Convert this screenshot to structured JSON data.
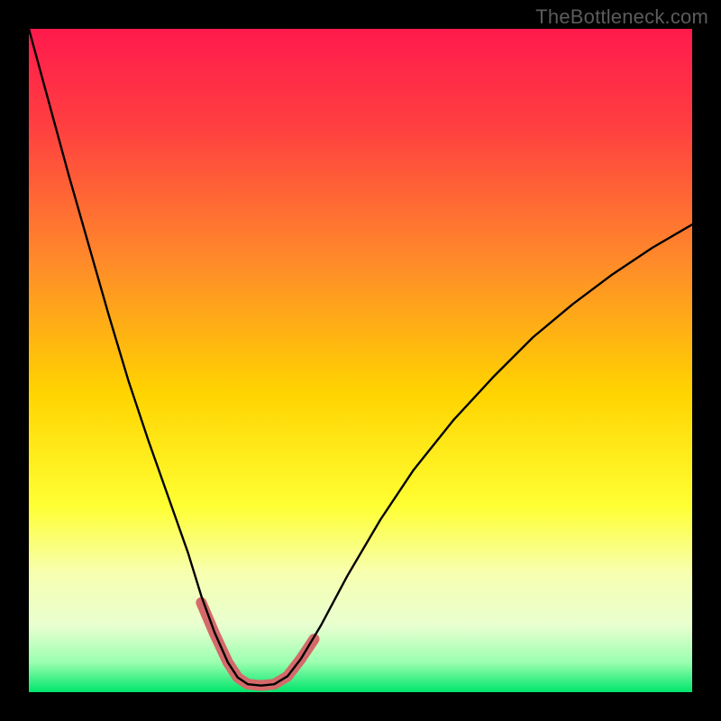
{
  "watermark": "TheBottleneck.com",
  "chart_data": {
    "type": "line",
    "title": "",
    "xlabel": "",
    "ylabel": "",
    "xlim": [
      0,
      100
    ],
    "ylim": [
      0,
      100
    ],
    "grid": false,
    "legend": false,
    "background_gradient": {
      "stops": [
        {
          "offset": 0.0,
          "color": "#ff1a4d"
        },
        {
          "offset": 0.15,
          "color": "#ff4040"
        },
        {
          "offset": 0.35,
          "color": "#ff8a2a"
        },
        {
          "offset": 0.55,
          "color": "#ffd400"
        },
        {
          "offset": 0.72,
          "color": "#ffff33"
        },
        {
          "offset": 0.82,
          "color": "#f7ffb0"
        },
        {
          "offset": 0.9,
          "color": "#e8ffd0"
        },
        {
          "offset": 0.955,
          "color": "#9bffb0"
        },
        {
          "offset": 1.0,
          "color": "#00e56b"
        }
      ]
    },
    "series": [
      {
        "name": "bottleneck-curve",
        "stroke": "#000000",
        "stroke_width": 2.4,
        "x": [
          0,
          3,
          6,
          9,
          12,
          15,
          18,
          21,
          24,
          26,
          28,
          30,
          31.5,
          33,
          35,
          37,
          39,
          41,
          44,
          48,
          53,
          58,
          64,
          70,
          76,
          82,
          88,
          94,
          100
        ],
        "values": [
          100,
          89,
          78,
          67.5,
          57,
          47,
          38,
          29.5,
          21,
          14.5,
          9,
          4.5,
          2.2,
          1.2,
          1.0,
          1.2,
          2.4,
          5.0,
          10,
          17.5,
          26,
          33.5,
          41,
          47.5,
          53.5,
          58.5,
          63,
          67,
          70.5
        ]
      }
    ],
    "highlight": {
      "name": "bottom-pink-segment",
      "color": "#d46a6a",
      "stroke_width": 12,
      "x": [
        26,
        28,
        30,
        31.5,
        33,
        35,
        37,
        39,
        41,
        43
      ],
      "values": [
        13.5,
        8.8,
        4.5,
        2.2,
        1.2,
        1.0,
        1.2,
        2.4,
        5.0,
        8.0
      ]
    }
  }
}
